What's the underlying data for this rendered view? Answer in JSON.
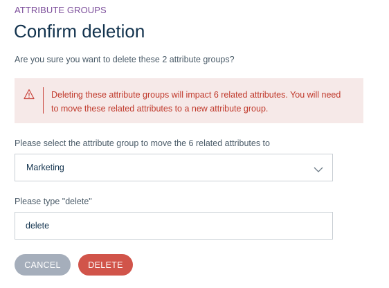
{
  "header": {
    "eyebrow": "ATTRIBUTE GROUPS",
    "title": "Confirm deletion"
  },
  "question": "Are you sure you want to delete these 2 attribute groups?",
  "warning": {
    "icon": "warning-triangle-icon",
    "message": "Deleting these attribute groups will impact 6 related attributes. You will need to move these related attributes to a new attribute group.",
    "background_color": "#f6e9e8",
    "text_color": "#c0392b"
  },
  "move_select": {
    "label": "Please select the attribute group to move the 6 related attributes to",
    "selected_value": "Marketing",
    "icon": "chevron-down-icon"
  },
  "confirm_input": {
    "label": "Please type \"delete\"",
    "value": "delete"
  },
  "actions": {
    "cancel_label": "CANCEL",
    "delete_label": "DELETE",
    "cancel_color": "#a5aebb",
    "delete_color": "#d1544a"
  },
  "colors": {
    "accent_purple": "#7b4d9a",
    "title_navy": "#11324d"
  }
}
